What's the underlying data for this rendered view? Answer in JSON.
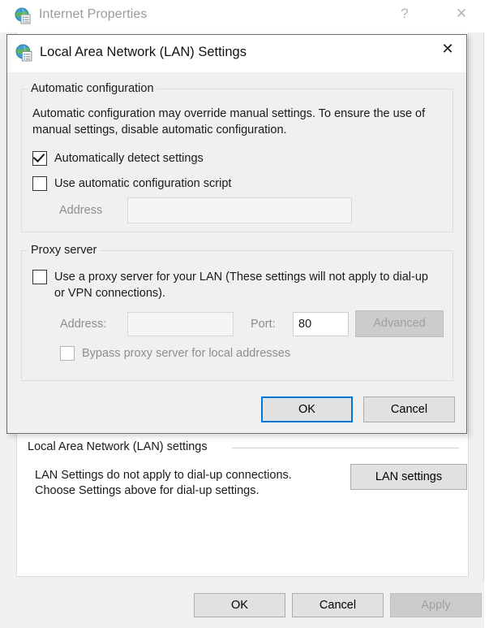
{
  "parent_window": {
    "title": "Internet Properties",
    "icon": "internet-properties-globe-icon",
    "help_button": "?",
    "close_button": "✕",
    "lan_group": {
      "title": "Local Area Network (LAN) settings",
      "description_line1": "LAN Settings do not apply to dial-up connections.",
      "description_line2": "Choose Settings above for dial-up settings.",
      "lan_settings_button": "LAN settings"
    },
    "footer": {
      "ok": "OK",
      "cancel": "Cancel",
      "apply": "Apply",
      "apply_enabled": false
    }
  },
  "dialog": {
    "title": "Local Area Network (LAN) Settings",
    "icon": "internet-properties-globe-icon",
    "close_button": "✕",
    "automatic_configuration": {
      "group_title": "Automatic configuration",
      "description": "Automatic configuration may override manual settings.  To ensure the use of manual settings, disable automatic configuration.",
      "auto_detect": {
        "label": "Automatically detect settings",
        "checked": true
      },
      "use_script": {
        "label": "Use automatic configuration script",
        "checked": false
      },
      "address_label": "Address",
      "address_value": "",
      "address_enabled": false
    },
    "proxy_server": {
      "group_title": "Proxy server",
      "use_proxy": {
        "label": "Use a proxy server for your LAN (These settings will not apply to dial-up or VPN connections).",
        "checked": false
      },
      "address_label": "Address:",
      "address_value": "",
      "port_label": "Port:",
      "port_value": "80",
      "advanced_button": "Advanced",
      "advanced_enabled": false,
      "bypass": {
        "label": "Bypass proxy server for local addresses",
        "checked": false,
        "enabled": false
      }
    },
    "footer": {
      "ok": "OK",
      "cancel": "Cancel",
      "default_button": "OK"
    }
  },
  "colors": {
    "dialog_background": "#f0f0f0",
    "window_background": "#ffffff",
    "focus_accent": "#0078d7",
    "button_face": "#e1e1e1",
    "disabled_text": "#a0a0a0"
  }
}
